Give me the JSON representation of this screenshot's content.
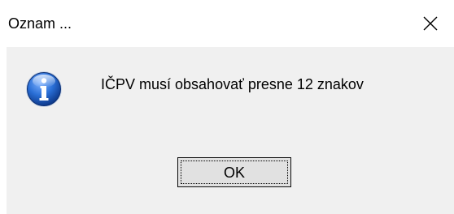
{
  "dialog": {
    "title": "Oznam ...",
    "message": "IČPV musí obsahovať presne 12 znakov",
    "ok_label": "OK",
    "close_icon": "close-icon",
    "info_icon": "info-icon"
  },
  "colors": {
    "content_background": "#f0f0f0",
    "titlebar_background": "#ffffff",
    "button_background": "#e1e1e1",
    "icon_blue": "#1f5fc4"
  }
}
